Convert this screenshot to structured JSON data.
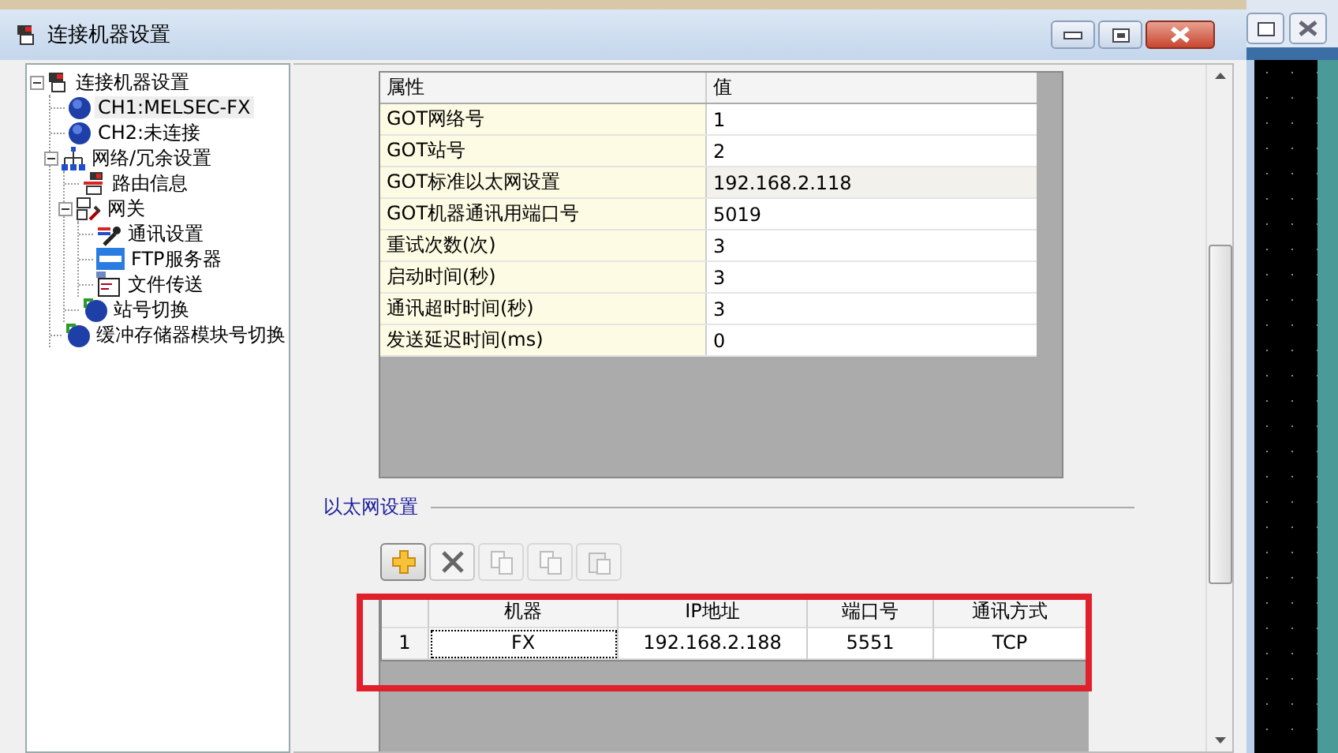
{
  "window": {
    "title": "连接机器设置"
  },
  "tree": [
    {
      "label": "连接机器设置",
      "kind": "device",
      "selected": false,
      "expanded": true,
      "children": [
        {
          "label": "CH1:MELSEC-FX",
          "kind": "channel",
          "selected": true
        },
        {
          "label": "CH2:未连接",
          "kind": "channel",
          "selected": false
        },
        {
          "label": "网络/冗余设置",
          "kind": "network",
          "selected": false,
          "expanded": true,
          "children": [
            {
              "label": "路由信息",
              "kind": "route",
              "selected": false
            },
            {
              "label": "网关",
              "kind": "gateway",
              "selected": false,
              "expanded": true,
              "children": [
                {
                  "label": "通讯设置",
                  "kind": "comm",
                  "selected": false
                },
                {
                  "label": "FTP服务器",
                  "kind": "ftp",
                  "selected": false
                },
                {
                  "label": "文件传送",
                  "kind": "file",
                  "selected": false
                }
              ]
            },
            {
              "label": "站号切换",
              "kind": "switch",
              "selected": false
            }
          ]
        },
        {
          "label": "缓冲存储器模块号切换",
          "kind": "switch",
          "selected": false
        }
      ]
    }
  ],
  "properties": {
    "columns": [
      "属性",
      "值"
    ],
    "rows": [
      {
        "name": "GOT网络号",
        "value": "1",
        "selected": false
      },
      {
        "name": "GOT站号",
        "value": "2",
        "selected": false
      },
      {
        "name": "GOT标准以太网设置",
        "value": "192.168.2.118",
        "selected": true
      },
      {
        "name": "GOT机器通讯用端口号",
        "value": "5019",
        "selected": false
      },
      {
        "name": "重试次数(次)",
        "value": "3",
        "selected": false
      },
      {
        "name": "启动时间(秒)",
        "value": "3",
        "selected": false
      },
      {
        "name": "通讯超时时间(秒)",
        "value": "3",
        "selected": false
      },
      {
        "name": "发送延迟时间(ms)",
        "value": "0",
        "selected": false
      }
    ]
  },
  "ethernet": {
    "title": "以太网设置",
    "toolbar": [
      {
        "kind": "add",
        "disabled": false
      },
      {
        "kind": "delete",
        "disabled": false
      },
      {
        "kind": "copy",
        "disabled": true
      },
      {
        "kind": "copy2",
        "disabled": true
      },
      {
        "kind": "paste",
        "disabled": true
      }
    ],
    "columns": [
      "机器",
      "IP地址",
      "端口号",
      "通讯方式"
    ],
    "rows": [
      {
        "number": "1",
        "cells": [
          {
            "text": "FX",
            "focused": true
          },
          {
            "text": "192.168.2.188",
            "focused": false
          },
          {
            "text": "5551",
            "focused": false
          },
          {
            "text": "TCP",
            "focused": false
          }
        ]
      }
    ],
    "highlighted": true
  }
}
